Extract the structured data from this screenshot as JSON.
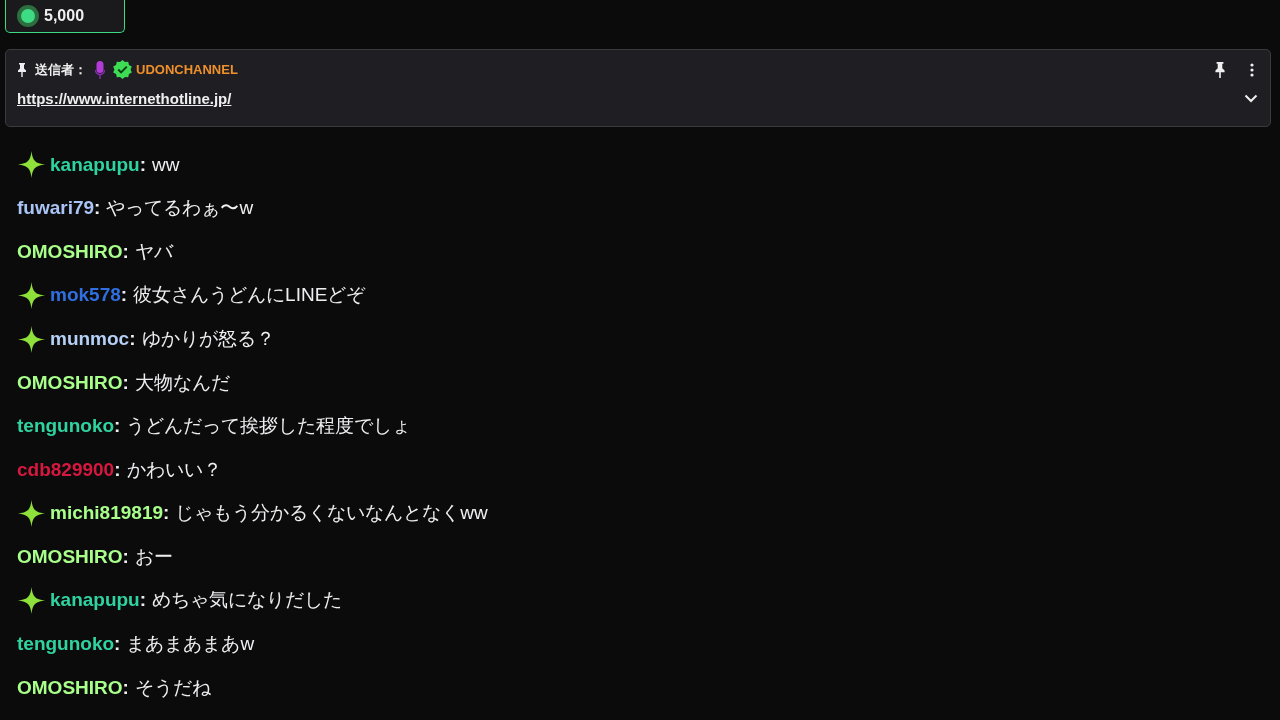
{
  "points_badge": {
    "amount": "5,000"
  },
  "pinned": {
    "label": "送信者：",
    "sender": "UDONCHANNEL",
    "sender_verified": true,
    "sender_mic": true,
    "link": "https://www.internethotline.jp/"
  },
  "messages": [
    {
      "badge": true,
      "name": "kanapupu",
      "color": "#2fd3a0",
      "separator": ":",
      "text": "ww"
    },
    {
      "badge": false,
      "name": "fuwari79",
      "color": "#a9c4f5",
      "separator": ":",
      "text": "やってるわぁ〜w"
    },
    {
      "badge": false,
      "name": "OMOSHIRO",
      "color": "#a8ff8a",
      "separator": ":",
      "text": "ヤバ"
    },
    {
      "badge": true,
      "name": "mok578",
      "color": "#2f6fe0",
      "separator": ":",
      "text": "彼女さんうどんにLINEどぞ"
    },
    {
      "badge": true,
      "name": "munmoc",
      "color": "#b5d0f5",
      "separator": ":",
      "text": "ゆかりが怒る？"
    },
    {
      "badge": false,
      "name": "OMOSHIRO",
      "color": "#a8ff8a",
      "separator": ":",
      "text": "大物なんだ"
    },
    {
      "badge": false,
      "name": "tengunoko",
      "color": "#2fd3a0",
      "separator": ":",
      "text": "うどんだって挨拶した程度でしょ"
    },
    {
      "badge": false,
      "name": "cdb829900",
      "color": "#d6183f",
      "separator": ":",
      "text": "かわいい？"
    },
    {
      "badge": true,
      "name": "michi819819",
      "color": "#a8ff8a",
      "separator": ":",
      "text": "じゃもう分かるくないなんとなくww"
    },
    {
      "badge": false,
      "name": "OMOSHIRO",
      "color": "#a8ff8a",
      "separator": ":",
      "text": "おー"
    },
    {
      "badge": true,
      "name": "kanapupu",
      "color": "#2fd3a0",
      "separator": ":",
      "text": "めちゃ気になりだした"
    },
    {
      "badge": false,
      "name": "tengunoko",
      "color": "#2fd3a0",
      "separator": ":",
      "text": "まあまあまあw"
    },
    {
      "badge": false,
      "name": "OMOSHIRO",
      "color": "#a8ff8a",
      "separator": ":",
      "text": "そうだね"
    }
  ]
}
